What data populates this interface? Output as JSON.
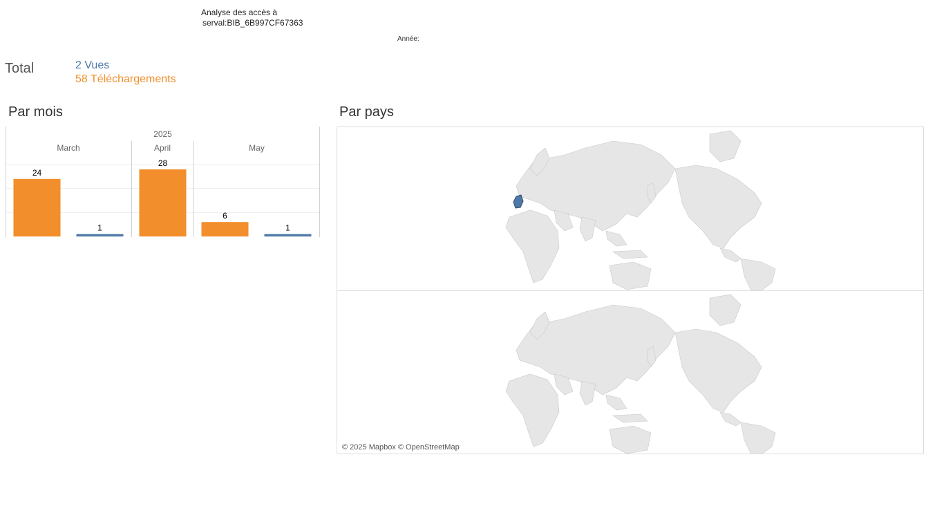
{
  "header": {
    "title_line1": "Analyse des accès à",
    "title_line2": "serval:BIB_6B997CF67363",
    "year_filter_label": "Année:"
  },
  "totals": {
    "label": "Total",
    "views": "2 Vues",
    "downloads": "58 Téléchargements"
  },
  "sections": {
    "by_month": "Par mois",
    "by_country": "Par pays"
  },
  "colors": {
    "downloads": "#f28e2b",
    "views": "#4e79a7",
    "map_land": "#e6e6e6",
    "map_highlight": "#4e79a7"
  },
  "chart_data": {
    "type": "bar",
    "year": "2025",
    "categories": [
      "March",
      "April",
      "May"
    ],
    "series": [
      {
        "name": "Téléchargements",
        "values": [
          24,
          28,
          6
        ]
      },
      {
        "name": "Vues",
        "values": [
          1,
          null,
          1
        ]
      }
    ],
    "ylim": [
      0,
      30
    ],
    "grid": true
  },
  "map": {
    "attribution": "© 2025 Mapbox © OpenStreetMap",
    "highlighted_country": "Switzerland"
  }
}
